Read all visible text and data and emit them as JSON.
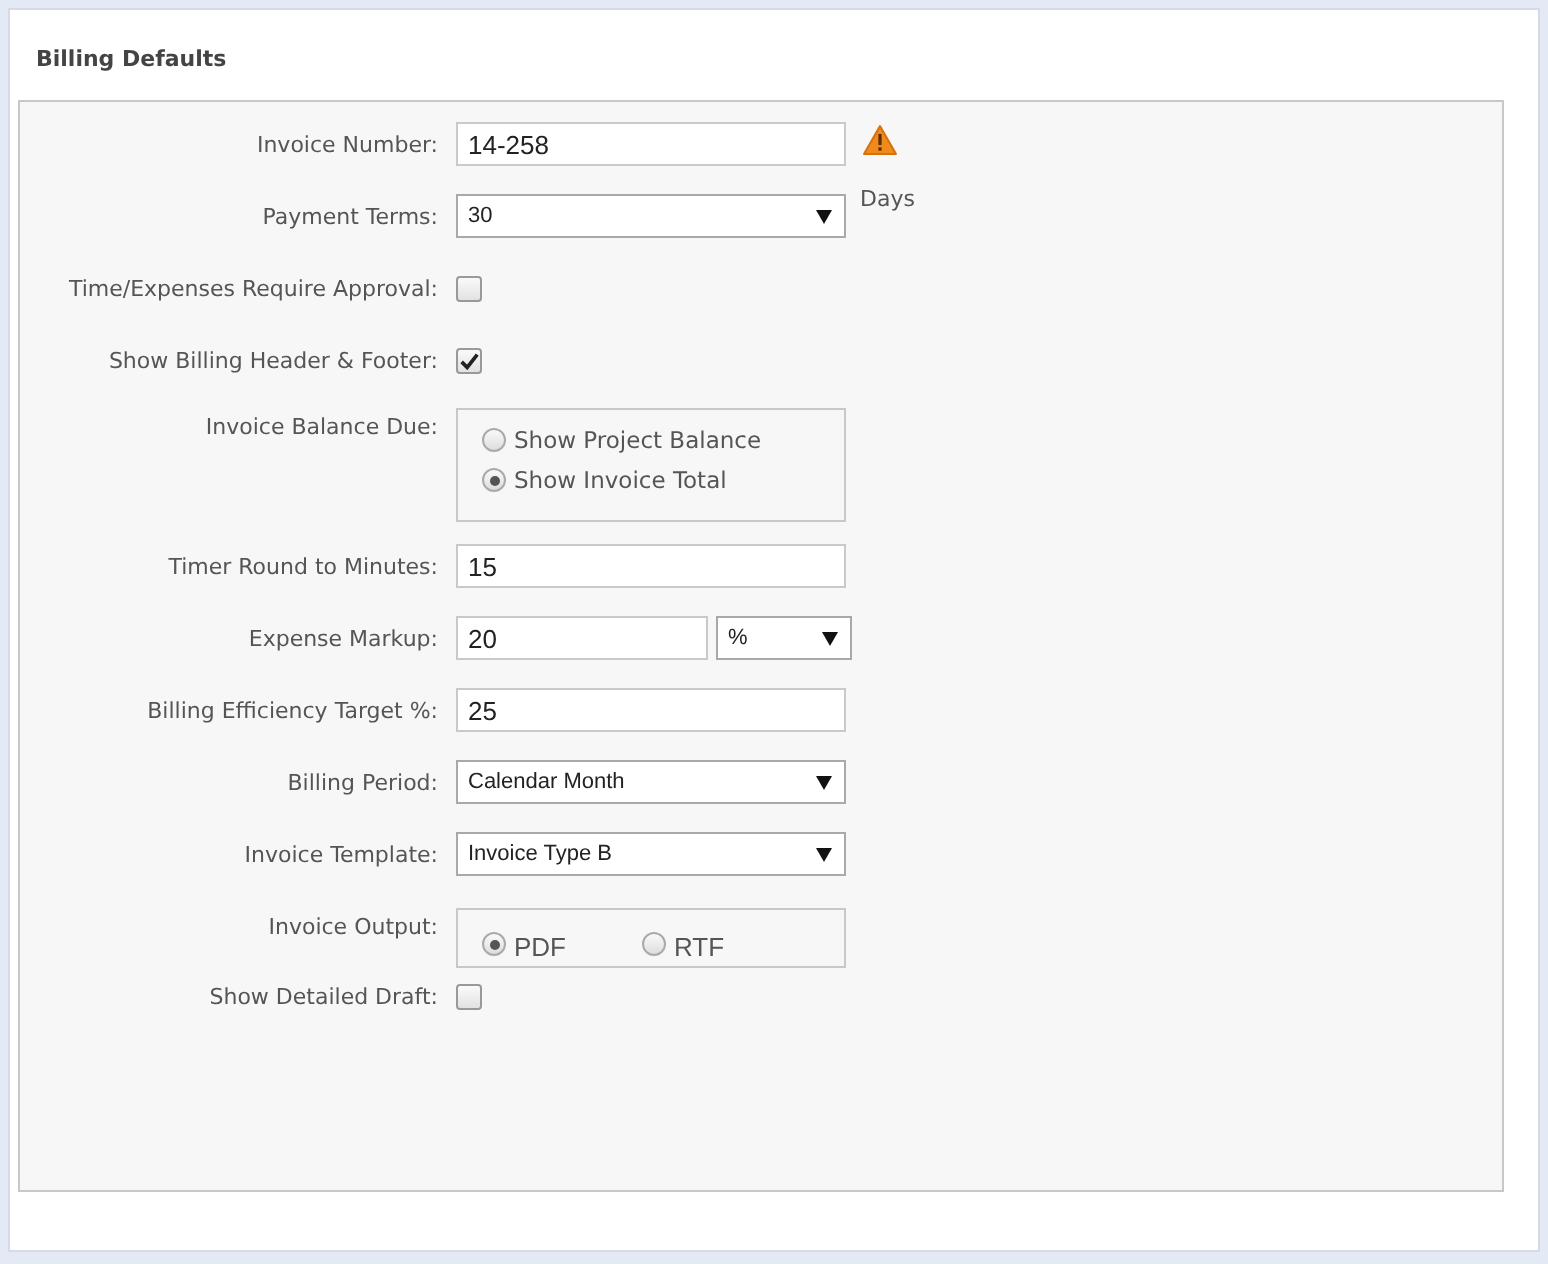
{
  "section": {
    "title": "Billing Defaults"
  },
  "fields": [
    {
      "kind": "text",
      "label": "Invoice Number:",
      "value": "14-258",
      "warning": true
    },
    {
      "kind": "select",
      "label": "Payment Terms:",
      "value": "30",
      "suffix": "Days"
    },
    {
      "kind": "checkbox",
      "label": "Time/Expenses Require Approval:",
      "checked": false
    },
    {
      "kind": "checkbox",
      "label": "Show Billing Header & Footer:",
      "checked": true
    },
    {
      "kind": "radio",
      "label": "Invoice Balance Due:",
      "inline": false,
      "options": [
        {
          "label": "Show Project Balance",
          "selected": false
        },
        {
          "label": "Show Invoice Total",
          "selected": true
        }
      ]
    },
    {
      "kind": "text",
      "label": "Timer Round to Minutes:",
      "value": "15"
    },
    {
      "kind": "text-select",
      "label": "Expense Markup:",
      "value": "20",
      "unit": "%"
    },
    {
      "kind": "text",
      "label": "Billing Efficiency Target %:",
      "value": "25"
    },
    {
      "kind": "select",
      "label": "Billing Period:",
      "value": "Calendar Month"
    },
    {
      "kind": "select",
      "label": "Invoice Template:",
      "value": "Invoice Type B"
    },
    {
      "kind": "radio",
      "label": "Invoice Output:",
      "inline": true,
      "options": [
        {
          "label": "PDF",
          "selected": true
        },
        {
          "label": "RTF",
          "selected": false
        }
      ]
    },
    {
      "kind": "checkbox",
      "label": "Show Detailed Draft:",
      "checked": false
    }
  ]
}
